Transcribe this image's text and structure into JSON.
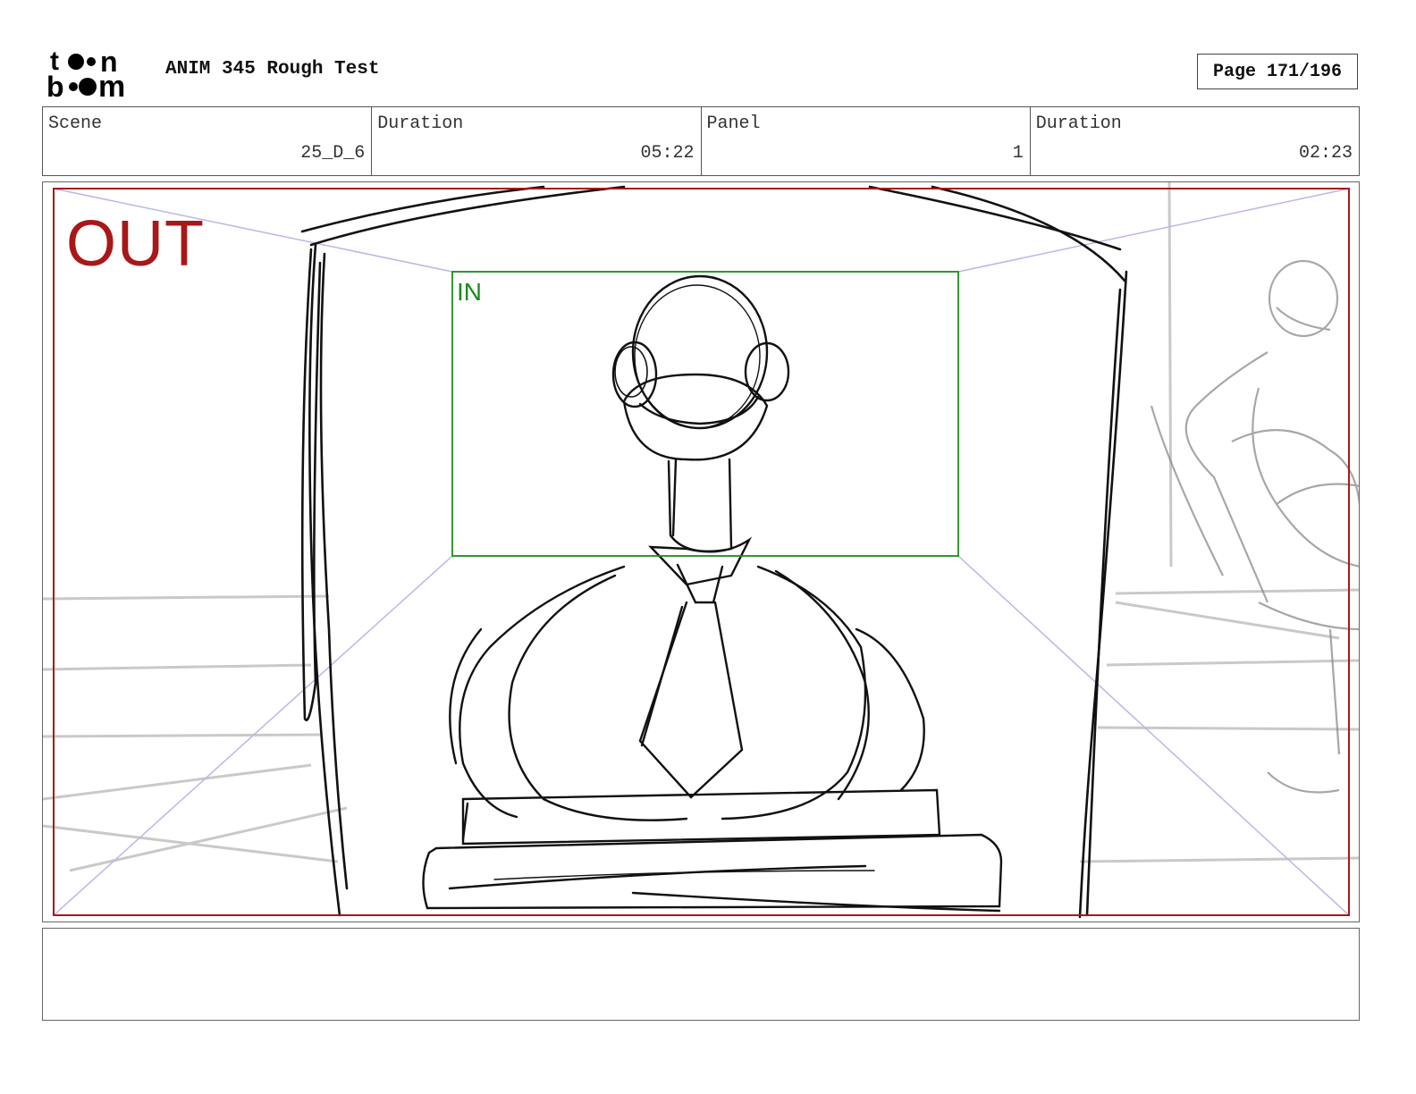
{
  "header": {
    "logo_text": "toon boom",
    "title": "ANIM 345 Rough Test",
    "page_label": "Page 171/196"
  },
  "info": {
    "scene_label": "Scene",
    "scene_value": "25_D_6",
    "duration_label": "Duration",
    "duration_value": "05:22",
    "panel_label": "Panel",
    "panel_value": "1",
    "panel_duration_label": "Duration",
    "panel_duration_value": "02:23"
  },
  "panel": {
    "out_label": "OUT",
    "in_label": "IN",
    "colors": {
      "out_frame": "#a81818",
      "in_frame": "#1d8a1d",
      "perspective": "#b8b8e8",
      "sketch": "#111111"
    }
  },
  "notes": {
    "text": ""
  }
}
